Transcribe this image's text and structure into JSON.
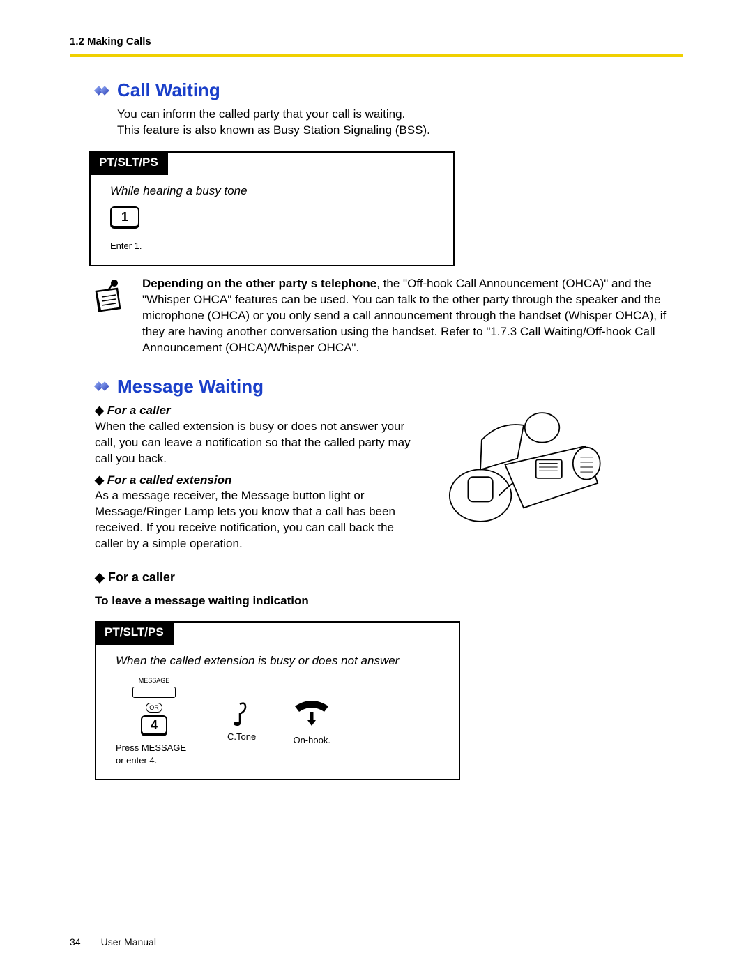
{
  "header": {
    "running": "1.2 Making Calls"
  },
  "section1": {
    "title": "Call Waiting",
    "intro1": "You can inform the called party that your call is waiting.",
    "intro2": "This feature is also known as Busy Station Signaling (BSS).",
    "proc": {
      "tab": "PT/SLT/PS",
      "context": "While hearing a busy tone",
      "key": "1",
      "caption": "Enter 1."
    },
    "note_bold": "Depending on the other party s telephone",
    "note_rest": ", the \"Off-hook Call Announcement (OHCA)\" and the \"Whisper OHCA\" features can be used. You can talk to the other party through the speaker and the microphone (OHCA) or you only send a call announcement through the handset (Whisper OHCA), if they are having another conversation using the handset. Refer to \"1.7.3 Call Waiting/Off-hook Call Announcement (OHCA)/Whisper OHCA\"."
  },
  "section2": {
    "title": "Message Waiting",
    "caller_h": "For a caller",
    "caller_body": "When the called extension is busy or does not answer your call, you can leave a notification so that the called party may call you back.",
    "called_h": "For a called extension",
    "called_body": "As a message receiver, the Message button light or Message/Ringer Lamp lets you know that a call has been received. If you receive notification, you can call back the caller by a simple operation.",
    "big_caller": "For a caller",
    "task": "To leave a message waiting indication",
    "proc": {
      "tab": "PT/SLT/PS",
      "context": "When the called extension is busy or does not answer",
      "msg_label": "MESSAGE",
      "or": "OR",
      "key": "4",
      "step1": "Press MESSAGE\nor enter 4.",
      "ctone": "C.Tone",
      "onhook": "On-hook."
    }
  },
  "footer": {
    "page": "34",
    "label": "User Manual"
  }
}
